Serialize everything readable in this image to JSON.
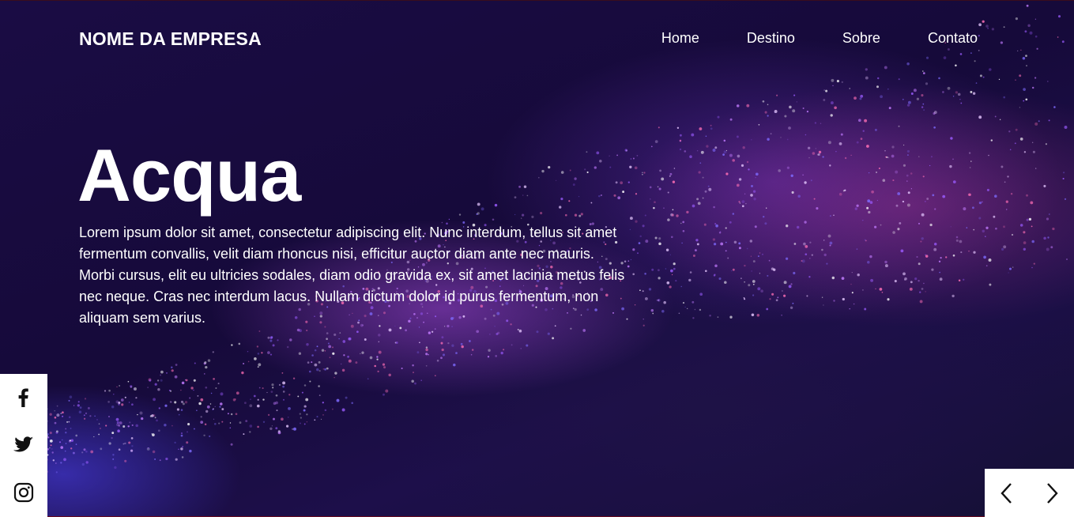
{
  "brand": "NOME DA EMPRESA",
  "nav": {
    "items": [
      "Home",
      "Destino",
      "Sobre",
      "Contato"
    ]
  },
  "hero": {
    "title": "Acqua",
    "description": "Lorem ipsum dolor sit amet, consectetur adipiscing elit. Nunc interdum, tellus sit amet fermentum convallis, velit diam rhoncus nisi, efficitur auctor diam ante nec mauris. Morbi cursus, elit eu ultricies sodales, diam odio gravida ex, sit amet lacinia metus felis nec neque. Cras nec interdum lacus. Nullam dictum dolor id purus fermentum, non aliquam sem varius."
  },
  "social": [
    "facebook-icon",
    "twitter-icon",
    "instagram-icon"
  ],
  "slider": {
    "prev_icon": "chevron-left-icon",
    "next_icon": "chevron-right-icon"
  },
  "colors": {
    "background": "#130a33",
    "accent_purple": "#b85cff",
    "accent_pink": "#e0509a",
    "text": "#ffffff",
    "panel": "#ffffff",
    "icon": "#111111"
  }
}
